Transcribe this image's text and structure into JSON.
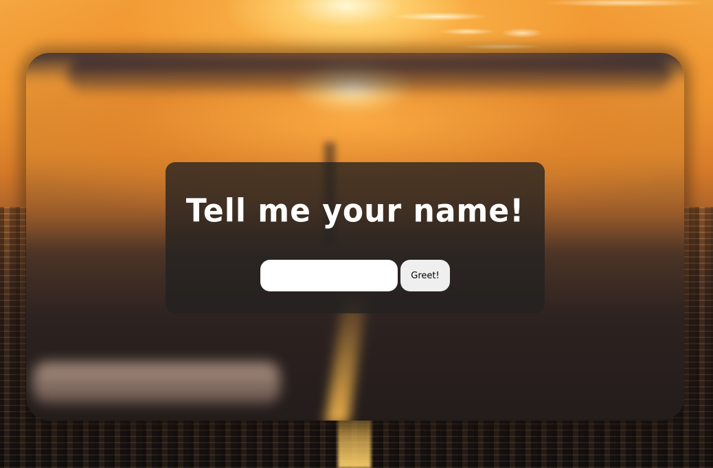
{
  "dialog": {
    "title": "Tell me your name!",
    "name_input": {
      "value": "",
      "placeholder": ""
    },
    "greet_label": "Greet!"
  },
  "colors": {
    "card_background": "#232121",
    "title_text": "#ffffff",
    "input_background": "#ffffff",
    "button_background": "#efefef"
  }
}
